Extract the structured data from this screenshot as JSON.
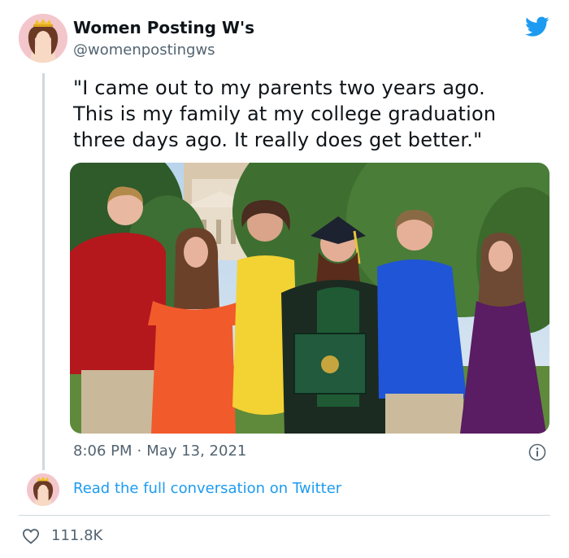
{
  "author": {
    "name": "Women Posting W's",
    "handle": "@womenpostingws"
  },
  "tweet": {
    "lines": [
      "\"I came out to my parents two years ago.",
      "This is my family at my college graduation",
      "three days ago. It really does get better.\""
    ],
    "time": "8:06 PM",
    "date": "May 13, 2021"
  },
  "footer": {
    "read_link": "Read the full conversation on Twitter",
    "likes": "111.8K"
  },
  "icons": {
    "brand": "twitter-bird-icon",
    "info": "info-icon",
    "like": "heart-icon"
  },
  "colors": {
    "link": "#1d9bf0",
    "secondary_text": "#536471",
    "brand": "#1d9bf0"
  }
}
